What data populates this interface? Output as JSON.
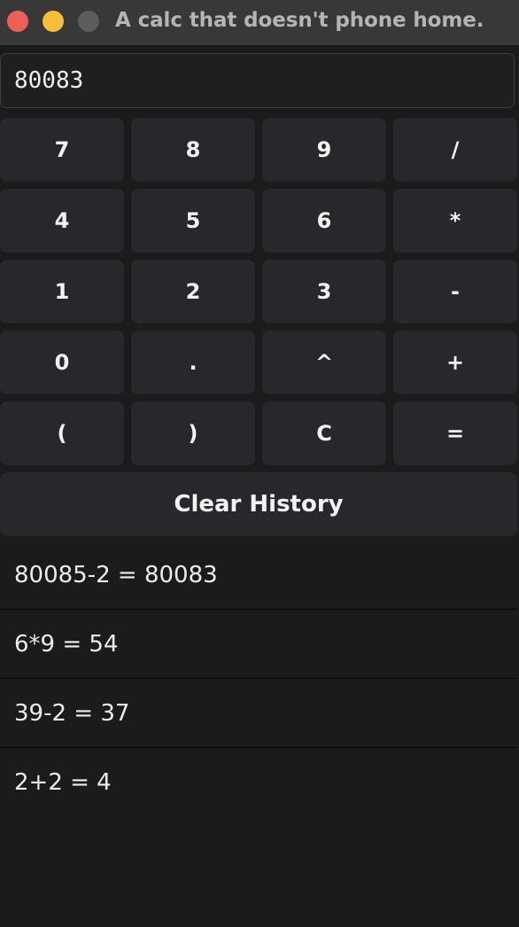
{
  "window": {
    "title": "A calc that doesn't phone home."
  },
  "display": {
    "value": "80083"
  },
  "keypad": {
    "rows": [
      [
        "7",
        "8",
        "9",
        "/"
      ],
      [
        "4",
        "5",
        "6",
        "*"
      ],
      [
        "1",
        "2",
        "3",
        "-"
      ],
      [
        "0",
        ".",
        "^",
        "+"
      ],
      [
        "(",
        ")",
        "C",
        "="
      ]
    ]
  },
  "clear_history_label": "Clear History",
  "history": [
    "80085-2 = 80083",
    "6*9 = 54",
    "39-2 = 37",
    "2+2 = 4"
  ],
  "colors": {
    "background": "#1b1b1c",
    "key": "#27282b",
    "close": "#ee5f58",
    "minimize": "#f6be3b",
    "maximize_inactive": "#5c5c5d"
  }
}
